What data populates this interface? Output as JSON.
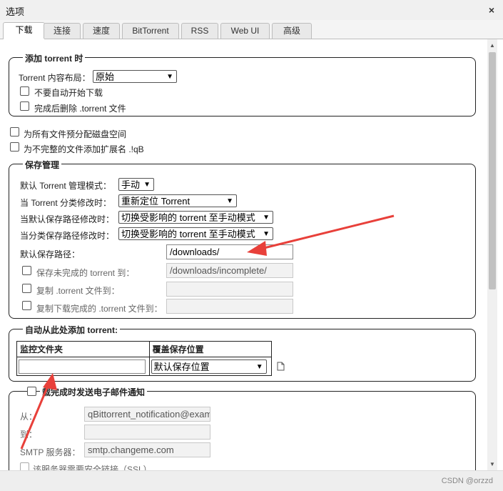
{
  "window": {
    "title": "选项",
    "close_glyph": "×"
  },
  "tabs": [
    {
      "label": "下载",
      "active": true
    },
    {
      "label": "连接",
      "active": false
    },
    {
      "label": "速度",
      "active": false
    },
    {
      "label": "BitTorrent",
      "active": false
    },
    {
      "label": "RSS",
      "active": false
    },
    {
      "label": "Web UI",
      "active": false
    },
    {
      "label": "高级",
      "active": false
    }
  ],
  "add_torrent": {
    "legend": "添加 torrent 时",
    "layout_label": "Torrent 内容布局：",
    "layout_value": "原始",
    "dont_start_label": "不要自动开始下载",
    "dont_start_checked": false,
    "delete_after_label": "完成后删除 .torrent 文件",
    "delete_after_checked": false
  },
  "preallocate": {
    "label": "为所有文件预分配磁盘空间",
    "checked": false
  },
  "append_ext": {
    "label": "为不完整的文件添加扩展名 .!qB",
    "checked": false
  },
  "save_management": {
    "legend": "保存管理",
    "default_mode_label": "默认 Torrent 管理模式：",
    "default_mode_value": "手动",
    "category_changed_label": "当 Torrent 分类修改时：",
    "category_changed_value": "重新定位 Torrent",
    "default_path_changed_label": "当默认保存路径修改时：",
    "default_path_changed_value": "切换受影响的 torrent 至手动模式",
    "category_path_changed_label": "当分类保存路径修改时：",
    "category_path_changed_value": "切换受影响的 torrent 至手动模式",
    "default_save_path_label": "默认保存路径：",
    "default_save_path_value": "/downloads/",
    "incomplete_label": "保存未完成的 torrent 到：",
    "incomplete_value": "/downloads/incomplete/",
    "incomplete_checked": false,
    "copy_torrent_label": "复制 .torrent 文件到：",
    "copy_torrent_value": "",
    "copy_torrent_checked": false,
    "copy_finished_label": "复制下载完成的 .torrent 文件到：",
    "copy_finished_value": "",
    "copy_finished_checked": false
  },
  "auto_add": {
    "legend": "自动从此处添加 torrent:",
    "col_monitor": "监控文件夹",
    "col_override": "覆盖保存位置",
    "row_folder_value": "",
    "row_location_value": "默认保存位置",
    "add_row_icon": "new-file-icon"
  },
  "email": {
    "legend": "下载完成时发送电子邮件通知",
    "legend_visible": "载完成时发送电子邮件通知",
    "checked": false,
    "from_label": "从：",
    "from_value": "qBittorrent_notification@example.com",
    "to_label": "到：",
    "to_value": "",
    "smtp_label": "SMTP 服务器：",
    "smtp_value": "smtp.changeme.com",
    "ssl_label": "该服务器需要安全链接（SSL）",
    "ssl_checked": false
  },
  "footer": {
    "watermark": "CSDN @orzzd"
  },
  "colors": {
    "annotation_arrow": "#e8403a",
    "border": "#222222",
    "disabled_bg": "#f2f2f2"
  }
}
